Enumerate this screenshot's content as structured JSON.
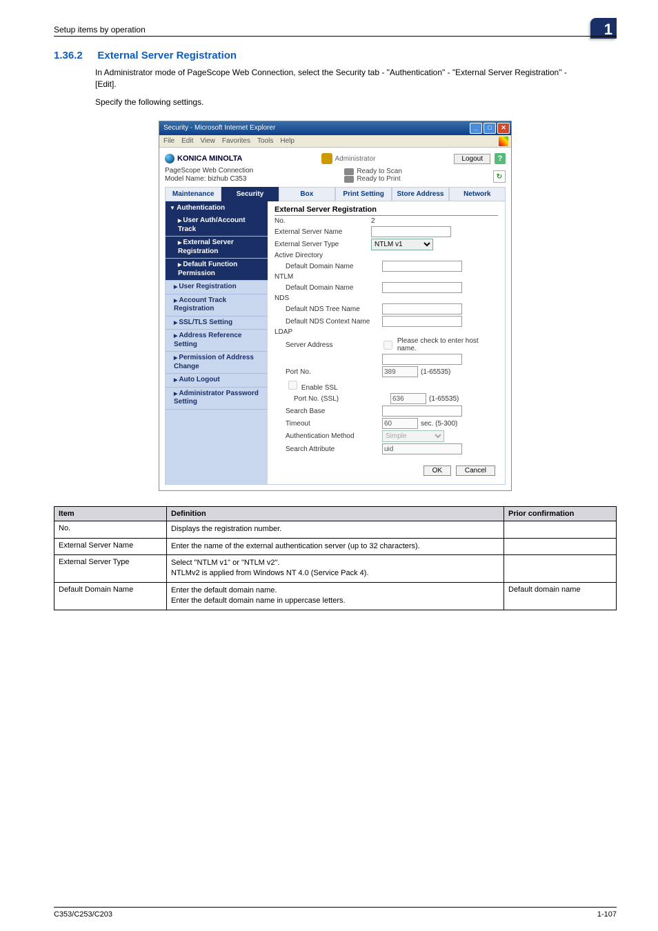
{
  "header": {
    "breadcrumb": "Setup items by operation",
    "badge": "1"
  },
  "section": {
    "number": "1.36.2",
    "title": "External Server Registration",
    "para1": "In Administrator mode of PageScope Web Connection, select the Security tab - \"Authentication\" - \"External Server Registration\" - [Edit].",
    "para2": "Specify the following settings."
  },
  "screenshot": {
    "window_title": "Security - Microsoft Internet Explorer",
    "ie_menu": [
      "File",
      "Edit",
      "View",
      "Favorites",
      "Tools",
      "Help"
    ],
    "brand": "KONICA MINOLTA",
    "admin_label": "Administrator",
    "logout": "Logout",
    "webconn": "PageScope Web Connection",
    "model": "Model Name: bizhub C353",
    "status1": "Ready to Scan",
    "status2": "Ready to Print",
    "tabs": [
      "Maintenance",
      "Security",
      "Box",
      "Print Setting",
      "Store Address",
      "Network"
    ],
    "active_tab": 1,
    "sidebar": {
      "header": "Authentication",
      "items": [
        {
          "label": "User Auth/Account Track",
          "cls": "sub"
        },
        {
          "label": "External Server Registration",
          "cls": "sub"
        },
        {
          "label": "Default Function Permission",
          "cls": "sub2"
        },
        {
          "label": "User Registration",
          "cls": "top"
        },
        {
          "label": "Account Track Registration",
          "cls": "top"
        },
        {
          "label": "SSL/TLS Setting",
          "cls": "top"
        },
        {
          "label": "Address Reference Setting",
          "cls": "top"
        },
        {
          "label": "Permission of Address Change",
          "cls": "top"
        },
        {
          "label": "Auto Logout",
          "cls": "top"
        },
        {
          "label": "Administrator Password Setting",
          "cls": "top"
        }
      ]
    },
    "form": {
      "title": "External Server Registration",
      "rows": {
        "no_lbl": "No.",
        "no_val": "2",
        "esn_lbl": "External Server Name",
        "est_lbl": "External Server Type",
        "est_val": "NTLM v1",
        "ad_grp": "Active Directory",
        "ddn_lbl": "Default Domain Name",
        "ntlm_grp": "NTLM",
        "ddn2_lbl": "Default Domain Name",
        "nds_grp": "NDS",
        "ndst_lbl": "Default NDS Tree Name",
        "ndsc_lbl": "Default NDS Context Name",
        "ldap_grp": "LDAP",
        "sa_lbl": "Server Address",
        "sa_chk": "Please check to enter host name.",
        "pn_lbl": "Port No.",
        "pn_val": "389",
        "pn_hint": "(1-65535)",
        "ssl_lbl": "Enable SSL",
        "pns_lbl": "Port No. (SSL)",
        "pns_val": "636",
        "pns_hint": "(1-65535)",
        "sb_lbl": "Search Base",
        "to_lbl": "Timeout",
        "to_val": "60",
        "to_hint": "sec. (5-300)",
        "am_lbl": "Authentication Method",
        "am_val": "Simple",
        "sat_lbl": "Search Attribute",
        "sat_val": "uid"
      },
      "ok": "OK",
      "cancel": "Cancel"
    }
  },
  "defs": {
    "head": {
      "c1": "Item",
      "c2": "Definition",
      "c3": "Prior confirmation"
    },
    "rows": [
      {
        "item": "No.",
        "def": "Displays the registration number.",
        "pc": ""
      },
      {
        "item": "External Server Name",
        "def": "Enter the name of the external authentication server (up to 32 characters).",
        "pc": ""
      },
      {
        "item": "External Server Type",
        "def": "Select \"NTLM v1\" or \"NTLM v2\".\nNTLMv2 is applied from Windows NT 4.0 (Service Pack 4).",
        "pc": ""
      },
      {
        "item": "Default Domain Name",
        "def": "Enter the default domain name.\nEnter the default domain name in uppercase letters.",
        "pc": "Default domain name"
      }
    ]
  },
  "footer": {
    "left": "C353/C253/C203",
    "right": "1-107"
  }
}
